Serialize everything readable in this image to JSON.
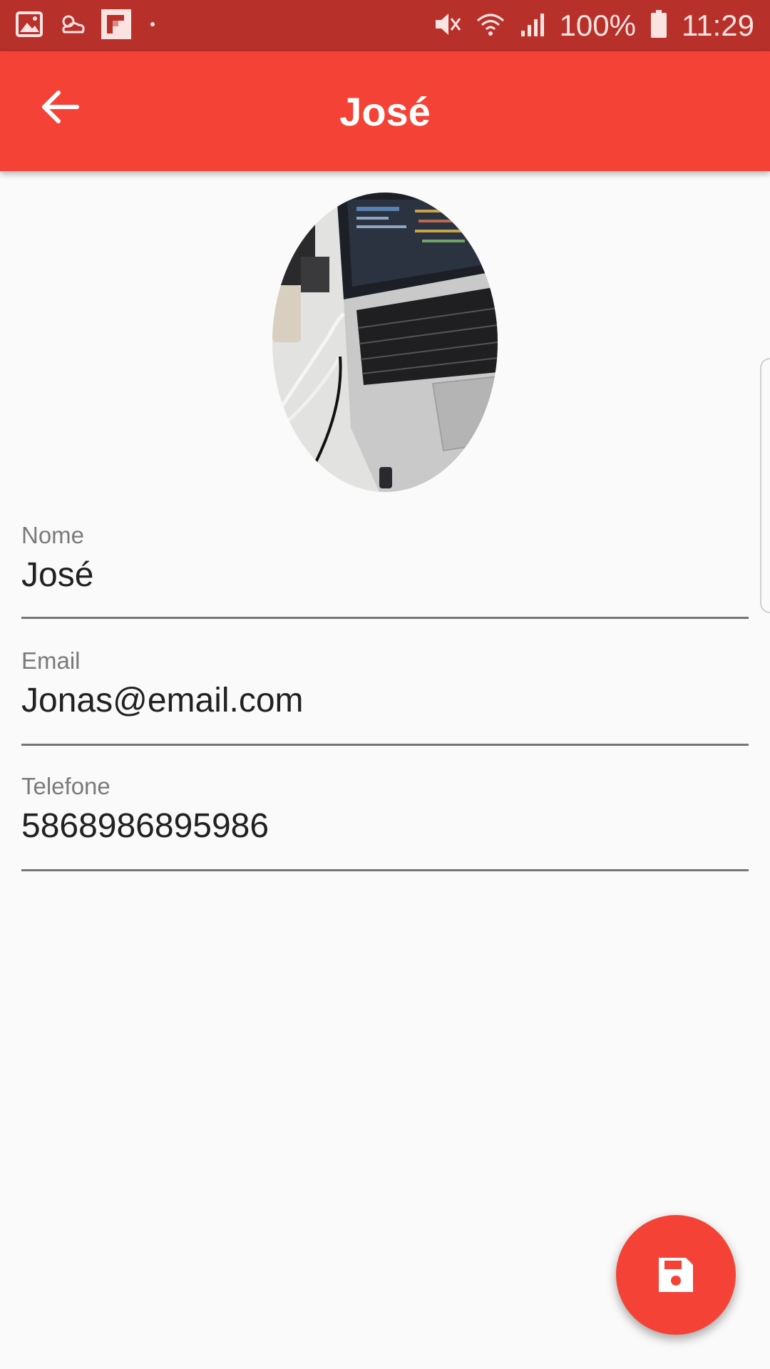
{
  "status_bar": {
    "battery": "100%",
    "time": "11:29",
    "icons_left": [
      "gallery-icon",
      "weather-icon",
      "flipboard-icon",
      "dot-icon"
    ],
    "icons_right": [
      "mute-icon",
      "wifi-icon",
      "signal-icon",
      "battery-icon"
    ]
  },
  "app_bar": {
    "title": "José",
    "back_icon": "arrow-back-icon",
    "color": "#f44336"
  },
  "avatar": {
    "description_icon": "contact-photo"
  },
  "form": {
    "name": {
      "label": "Nome",
      "value": "José"
    },
    "email": {
      "label": "Email",
      "value": "Jonas@email.com"
    },
    "phone": {
      "label": "Telefone",
      "value": "5868986895986"
    }
  },
  "fab": {
    "icon": "save-icon",
    "color": "#f44336"
  }
}
